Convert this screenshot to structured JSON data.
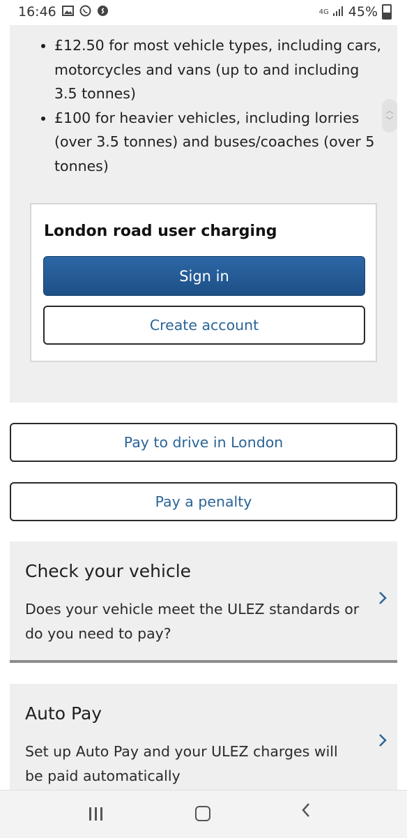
{
  "status_bar": {
    "time": "16:46",
    "network": "4G",
    "battery": "45%",
    "icons": [
      "gallery-icon",
      "whatsapp-icon",
      "shazam-icon",
      "signal-icon",
      "battery-icon"
    ]
  },
  "bullets": [
    "£12.50 for most vehicle types, including cars, motorcycles and vans (up to and including 3.5 tonnes)",
    "£100 for heavier vehicles, including lorries (over 3.5 tonnes) and buses/coaches (over 5 tonnes)"
  ],
  "account_card": {
    "title": "London road user charging",
    "sign_in": "Sign in",
    "create_account": "Create account"
  },
  "actions": {
    "pay_to_drive": "Pay to drive in London",
    "pay_penalty": "Pay a penalty"
  },
  "info_cards": [
    {
      "title": "Check your vehicle",
      "description": "Does your vehicle meet the ULEZ standards or do you need to pay?"
    },
    {
      "title": "Auto Pay",
      "description": "Set up Auto Pay and your ULEZ charges will be paid automatically"
    }
  ],
  "colors": {
    "primary_button": "#1d4f86",
    "link_text": "#2a6496",
    "panel_background": "#efefef"
  }
}
